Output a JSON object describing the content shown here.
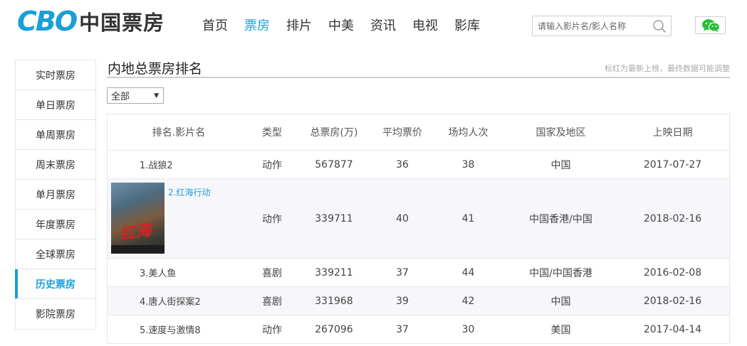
{
  "logo": {
    "brand": "CBO",
    "cn": "中国票房"
  },
  "nav": [
    "首页",
    "票房",
    "排片",
    "中美",
    "资讯",
    "电视",
    "影库"
  ],
  "nav_active": 1,
  "search": {
    "placeholder": "请输入影片名/影人名称"
  },
  "sidebar": {
    "items": [
      "实时票房",
      "单日票房",
      "单周票房",
      "周末票房",
      "单月票房",
      "年度票房",
      "全球票房",
      "历史票房",
      "影院票房"
    ],
    "active": 7
  },
  "main": {
    "title": "内地总票房排名",
    "note": "标红为最新上榜，最终数据可能调整",
    "filter": "全部"
  },
  "table": {
    "headers": [
      "排名.影片名",
      "类型",
      "总票房(万)",
      "平均票价",
      "场均人次",
      "国家及地区",
      "上映日期"
    ],
    "rows": [
      {
        "name": "1.战狼2",
        "type": "动作",
        "total": "567877",
        "avg": "36",
        "audience": "38",
        "country": "中国",
        "date": "2017-07-27"
      },
      {
        "name": "2.红海行动",
        "type": "动作",
        "total": "339711",
        "avg": "40",
        "audience": "41",
        "country": "中国香港/中国",
        "date": "2018-02-16"
      },
      {
        "name": "3.美人鱼",
        "type": "喜剧",
        "total": "339211",
        "avg": "37",
        "audience": "44",
        "country": "中国/中国香港",
        "date": "2016-02-08"
      },
      {
        "name": "4.唐人街探案2",
        "type": "喜剧",
        "total": "331968",
        "avg": "39",
        "audience": "42",
        "country": "中国",
        "date": "2018-02-16"
      },
      {
        "name": "5.速度与激情8",
        "type": "动作",
        "total": "267096",
        "avg": "37",
        "audience": "30",
        "country": "美国",
        "date": "2017-04-14"
      }
    ]
  },
  "colors": {
    "accent": "#1a9fd8",
    "wechat": "#2dbe3f",
    "row_alt": "#f7f6fa"
  }
}
